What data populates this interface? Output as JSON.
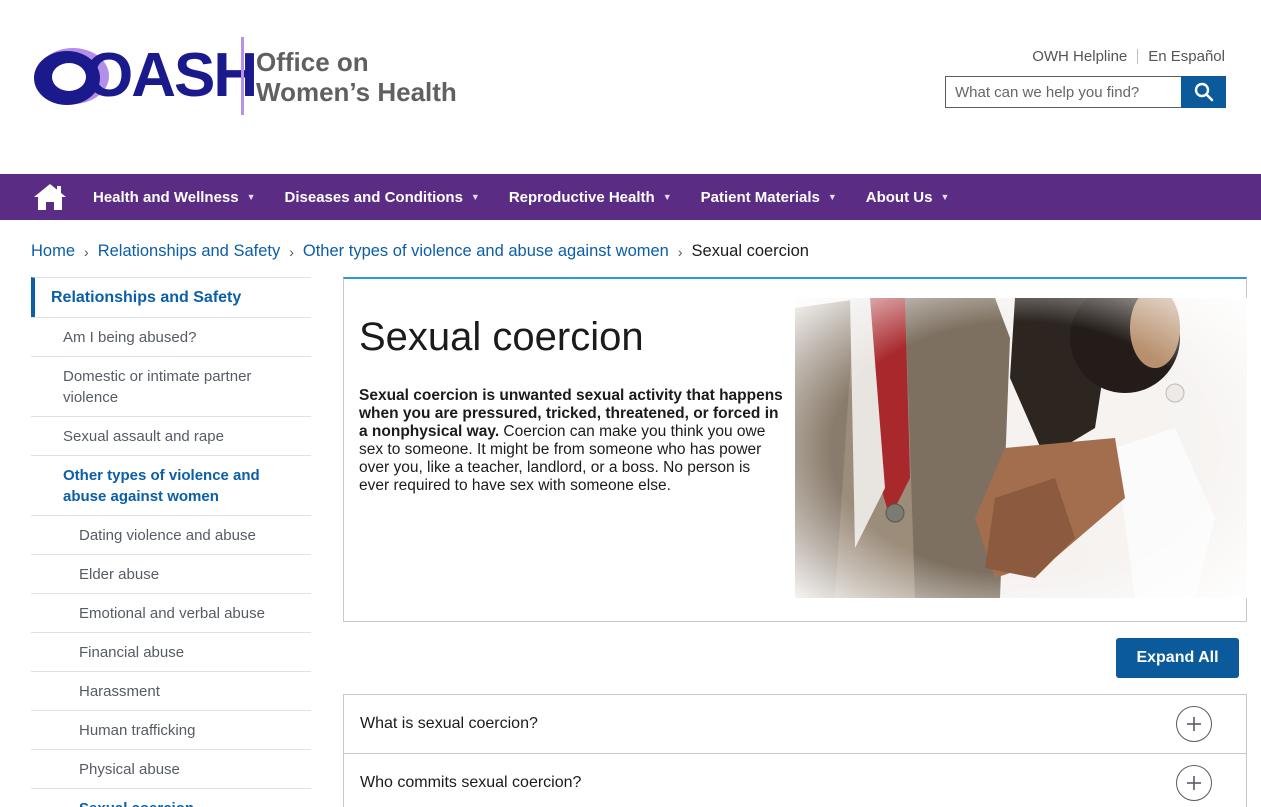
{
  "header": {
    "logo_text": "OASH",
    "office_line1": "Office on",
    "office_line2": "Women’s Health",
    "util_links": [
      "OWH Helpline",
      "En Español"
    ],
    "search_placeholder": "What can we help you find?"
  },
  "nav": {
    "items": [
      "Health and Wellness",
      "Diseases and Conditions",
      "Reproductive Health",
      "Patient Materials",
      "About Us"
    ]
  },
  "breadcrumb": {
    "links": [
      "Home",
      "Relationships and Safety",
      "Other types of violence and abuse against women"
    ],
    "current": "Sexual coercion"
  },
  "sidebar": {
    "heading": "Relationships and Safety",
    "items": [
      "Am I being abused?",
      "Domestic or intimate partner violence",
      "Sexual assault and rape",
      "Other types of violence and abuse against women"
    ],
    "subitems": [
      "Dating violence and abuse",
      "Elder abuse",
      "Emotional and verbal abuse",
      "Financial abuse",
      "Harassment",
      "Human trafficking",
      "Physical abuse",
      "Sexual coercion"
    ]
  },
  "main": {
    "title": "Sexual coercion",
    "intro_bold": "Sexual coercion is unwanted sexual activity that happens when you are pressured, tricked, threatened, or forced in a nonphysical way.",
    "intro_rest": " Coercion can make you think you owe sex to someone. It might be from someone who has power over you, like a teacher, landlord, or a boss. No person is ever required to have sex with someone else.",
    "expand_all": "Expand All",
    "accordion": [
      "What is sexual coercion?",
      "Who commits sexual coercion?"
    ]
  },
  "colors": {
    "nav_purple": "#5b2c83",
    "link_blue": "#0b5ea8",
    "button_blue": "#0a5a9c"
  }
}
